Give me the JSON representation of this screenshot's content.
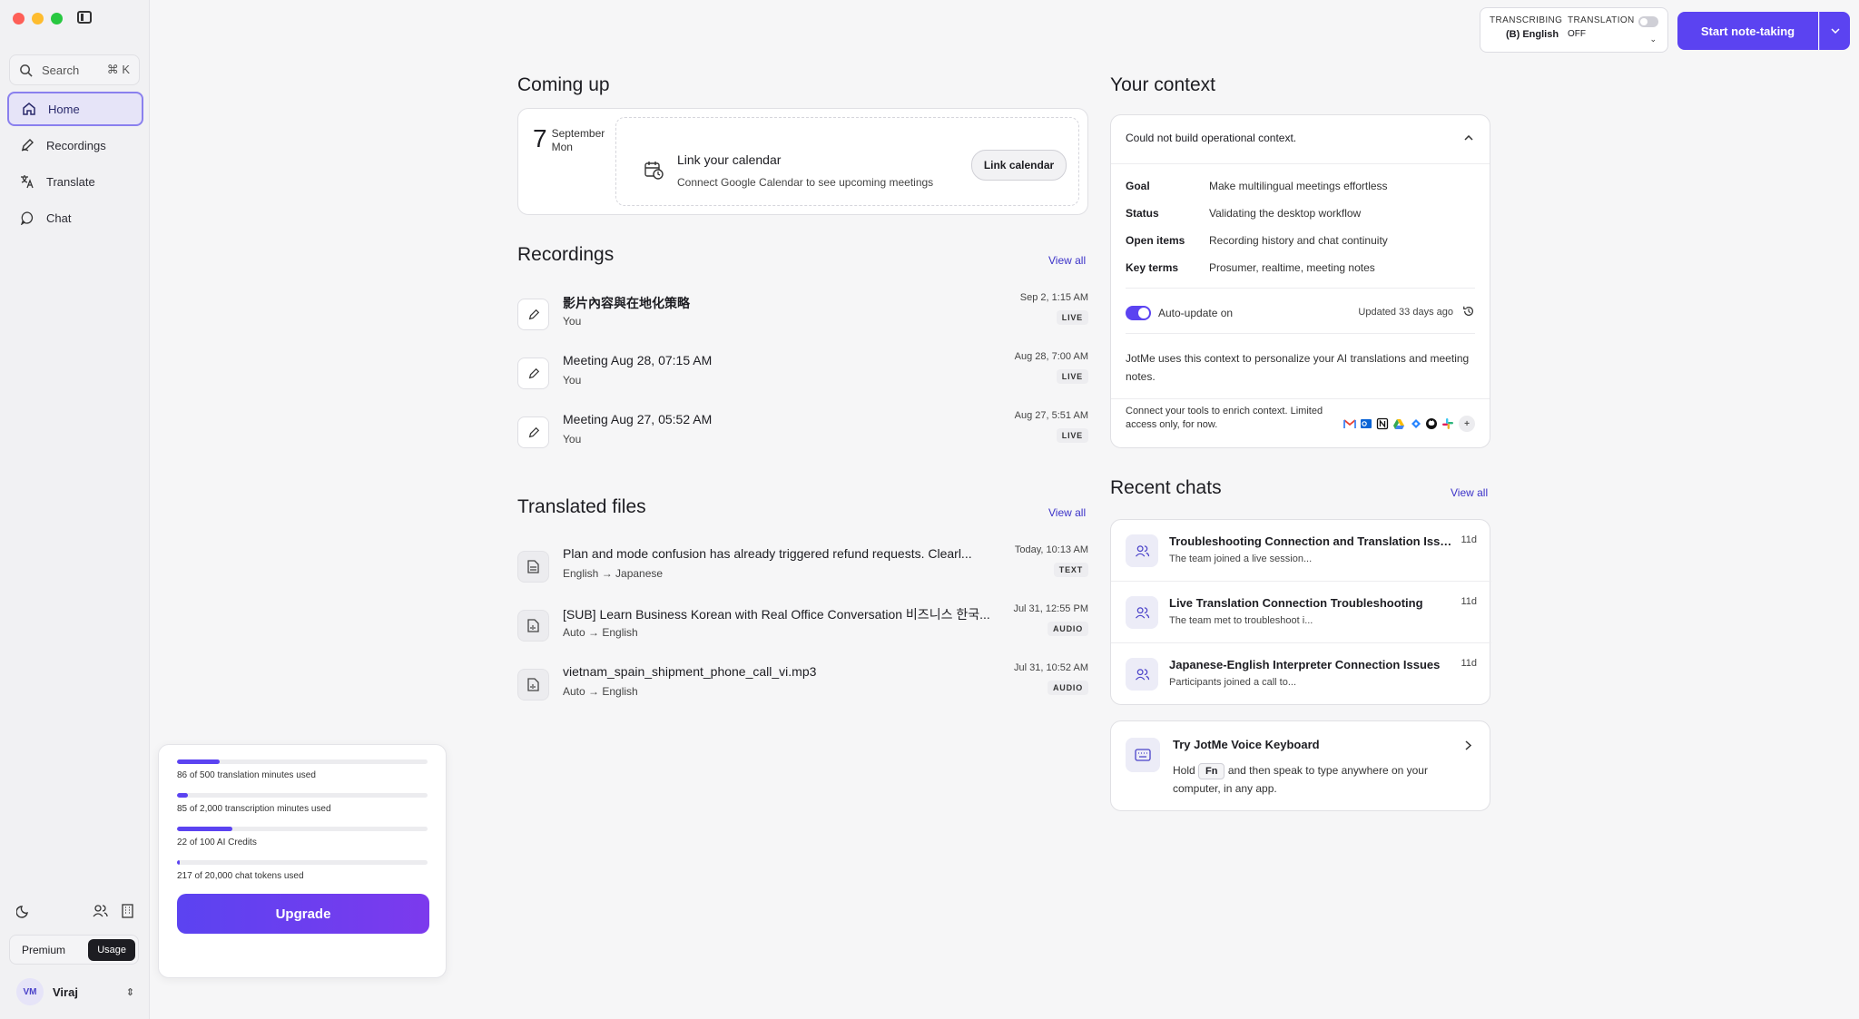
{
  "sidebar": {
    "search": {
      "label": "Search",
      "shortcut": "⌘ K"
    },
    "items": [
      {
        "label": "Home",
        "icon": "home-icon",
        "active": true
      },
      {
        "label": "Recordings",
        "icon": "pen-icon"
      },
      {
        "label": "Translate",
        "icon": "translate-icon"
      },
      {
        "label": "Chat",
        "icon": "chat-bubble-icon"
      }
    ],
    "plan": {
      "premium": "Premium",
      "usage": "Usage"
    },
    "user": {
      "initials": "VM",
      "name": "Viraj"
    }
  },
  "usage": {
    "rows": [
      {
        "label": "86 of 500 translation minutes used",
        "fraction": 0.172
      },
      {
        "label": "85 of 2,000 transcription minutes used",
        "fraction": 0.0425
      },
      {
        "label": "22 of 100 AI Credits",
        "fraction": 0.22
      },
      {
        "label": "217 of 20,000 chat tokens used",
        "fraction": 0.011
      }
    ],
    "upgrade_label": "Upgrade"
  },
  "topbar": {
    "transcribing_label": "TRANSCRIBING",
    "transcribing_value": "(B) English",
    "translation_label": "TRANSLATION",
    "translation_value": "OFF",
    "start_label": "Start note-taking"
  },
  "coming_up": {
    "title": "Coming up",
    "day": "7",
    "month": "September",
    "weekday": "Mon",
    "cal_title": "Link your calendar",
    "cal_sub": "Connect Google Calendar to see upcoming meetings",
    "cal_button": "Link calendar"
  },
  "recordings": {
    "title": "Recordings",
    "view_all": "View all",
    "items": [
      {
        "title": "影片內容與在地化策略",
        "sub": "You",
        "time": "Sep 2, 1:15 AM",
        "badge": "LIVE"
      },
      {
        "title": "Meeting Aug 28, 07:15 AM",
        "sub": "You",
        "time": "Aug 28, 7:00 AM",
        "badge": "LIVE"
      },
      {
        "title": "Meeting Aug 27, 05:52 AM",
        "sub": "You",
        "time": "Aug 27, 5:51 AM",
        "badge": "LIVE"
      }
    ]
  },
  "translated_files": {
    "title": "Translated files",
    "view_all": "View all",
    "items": [
      {
        "title": "Plan and mode confusion has already triggered refund requests. Clearl...",
        "sub": "English → Japanese",
        "time": "Today, 10:13 AM",
        "badge": "TEXT"
      },
      {
        "title": "[SUB] Learn Business Korean with Real Office Conversation 비즈니스 한국...",
        "sub": "Auto → English",
        "time": "Jul 31, 12:55 PM",
        "badge": "AUDIO"
      },
      {
        "title": "vietnam_spain_shipment_phone_call_vi.mp3",
        "sub": "Auto → English",
        "time": "Jul 31, 10:52 AM",
        "badge": "AUDIO"
      }
    ]
  },
  "context": {
    "title": "Your context",
    "header": "Could not build operational context.",
    "rows": [
      {
        "k": "Goal",
        "v": "Make multilingual meetings effortless"
      },
      {
        "k": "Status",
        "v": "Validating the desktop workflow"
      },
      {
        "k": "Open items",
        "v": "Recording history and chat continuity"
      },
      {
        "k": "Key terms",
        "v": "Prosumer, realtime, meeting notes"
      }
    ],
    "auto_update": "Auto-update on",
    "updated": "Updated 33 days ago",
    "description": "JotMe uses this context to personalize your AI translations and meeting notes.",
    "connect": "Connect your tools to enrich context. Limited access only, for now."
  },
  "recent_chats": {
    "title": "Recent chats",
    "view_all": "View all",
    "items": [
      {
        "title": "Troubleshooting Connection and Translation Issu...",
        "sub": "The team joined a live session...",
        "age": "11d"
      },
      {
        "title": "Live Translation Connection Troubleshooting",
        "sub": "The team met to troubleshoot i...",
        "age": "11d"
      },
      {
        "title": "Japanese-English Interpreter Connection Issues",
        "sub": "Participants joined a call to...",
        "age": "11d"
      }
    ]
  },
  "keyboard_promo": {
    "title": "Try JotMe Voice Keyboard",
    "pre": "Hold",
    "key": "Fn",
    "post": "and then speak to type anywhere on your computer, in any app."
  },
  "colors": {
    "accent": "#5b43f1",
    "background": "#f6f6f7"
  }
}
